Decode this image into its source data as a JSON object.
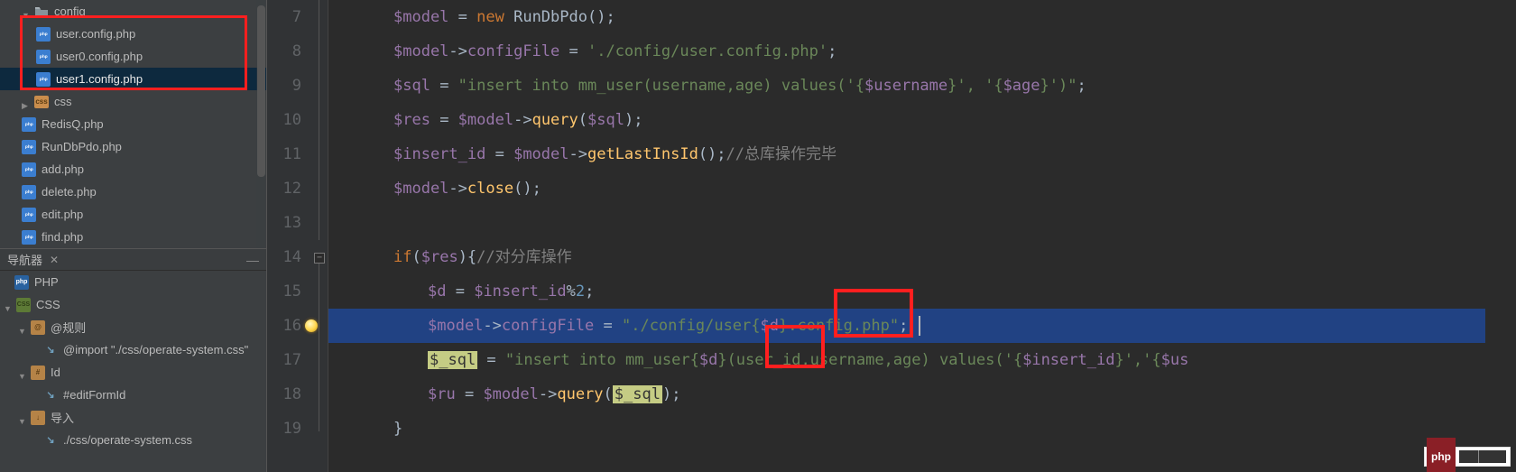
{
  "colors": {
    "highlight_red": "#ff1f1f",
    "selection_bg": "#214283"
  },
  "sidebar": {
    "root": {
      "label": "config",
      "expanded": true
    },
    "files": [
      {
        "label": "user.config.php",
        "selected": false
      },
      {
        "label": "user0.config.php",
        "selected": false
      },
      {
        "label": "user1.config.php",
        "selected": true
      }
    ],
    "other_root": "css",
    "root_files": [
      "RedisQ.php",
      "RunDbPdo.php",
      "add.php",
      "delete.php",
      "edit.php",
      "find.php"
    ]
  },
  "navigator": {
    "title": "导航器",
    "root": "PHP",
    "css": "CSS",
    "rules": "@规则",
    "import_rule": "@import \"./css/operate-system.css\"",
    "id_section": "Id",
    "id_item": "#editFormId",
    "import_section": "导入",
    "import_item": "./css/operate-system.css"
  },
  "code": {
    "lines": {
      "7": {
        "pre": "$model",
        "post": " = ",
        "kw": "new",
        "cls": " RunDbPdo();"
      },
      "8": {
        "pre": "$model",
        "call": "configFile",
        "eq": " = ",
        "str": "'./config/user.config.php'",
        "end": ";"
      },
      "9": {
        "pre": "$sql",
        "eq": " = ",
        "str": "\"insert into mm_user(username,age) values('{",
        "v1": "$username",
        "mid": "}', '{",
        "v2": "$age",
        "endstr": "}')\"",
        "end": ";"
      },
      "10": {
        "pre": "$res",
        "eq": " = ",
        "obj": "$model",
        "call": "query",
        "arg": "$sql",
        "end": ");"
      },
      "11": {
        "pre": "$insert_id",
        "eq": " = ",
        "obj": "$model",
        "call": "getLastInsId",
        "end": "();",
        "cmt": "//总库操作完毕"
      },
      "12": {
        "obj": "$model",
        "call": "close",
        "end": "();"
      },
      "13": "",
      "14": {
        "kw": "if",
        "cond": "$res",
        "brace": "){",
        "cmt": "//对分库操作"
      },
      "15": {
        "pre": "$d",
        "eq": " = ",
        "v": "$insert_id",
        "op": "%",
        "num": "2",
        "end": ";"
      },
      "16": {
        "obj": "$model",
        "call": "configFile",
        "eq": " = ",
        "s1": "\"./config/user{",
        "sv": "$d",
        "s2": "}.config.php\"",
        "end": ";"
      },
      "17": {
        "hl1": "$_sql",
        "eq": " = ",
        "s1": "\"insert into mm_user{",
        "sv": "$d",
        "s2": "}(user_id,username,age) values('{",
        "v2": "$insert_id",
        "s3": "}','{",
        "tail": "$us"
      },
      "18": {
        "pre": "$ru",
        "eq": " = ",
        "obj": "$model",
        "call": "query",
        "arg_hl": "$_sql",
        "end": ");"
      },
      "19": {
        "brace": "}"
      }
    },
    "line_numbers": [
      "7",
      "8",
      "9",
      "10",
      "11",
      "12",
      "13",
      "14",
      "15",
      "16",
      "17",
      "18",
      "19"
    ]
  },
  "watermark": "php"
}
